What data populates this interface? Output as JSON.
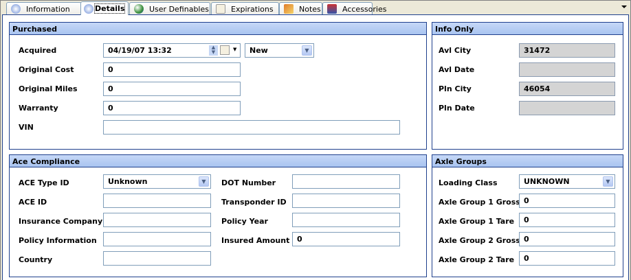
{
  "tabs": [
    {
      "label": "Information",
      "icon": "info-icon"
    },
    {
      "label": "Details",
      "icon": "info-icon"
    },
    {
      "label": "User Definables",
      "icon": "globe-icon"
    },
    {
      "label": "Expirations",
      "icon": "calendar-icon"
    },
    {
      "label": "Notes",
      "icon": "pencil-icon"
    },
    {
      "label": "Accessories",
      "icon": "accessories-icon"
    }
  ],
  "active_tab": "Details",
  "purchased": {
    "title": "Purchased",
    "acquired_label": "Acquired",
    "acquired_value": "04/19/07 13:32",
    "condition_value": "New",
    "original_cost_label": "Original Cost",
    "original_cost": "0",
    "original_miles_label": "Original Miles",
    "original_miles": "0",
    "warranty_label": "Warranty",
    "warranty": "0",
    "vin_label": "VIN",
    "vin": ""
  },
  "info_only": {
    "title": "Info Only",
    "avl_city_label": "Avl City",
    "avl_city": "31472",
    "avl_date_label": "Avl Date",
    "avl_date": "",
    "pln_city_label": "Pln City",
    "pln_city": "46054",
    "pln_date_label": "Pln Date",
    "pln_date": ""
  },
  "ace": {
    "title": "Ace Compliance",
    "type_id_label": "ACE Type ID",
    "type_id": "Unknown",
    "ace_id_label": "ACE ID",
    "ace_id": "",
    "insurance_company_label": "Insurance Company",
    "insurance_company": "",
    "policy_information_label": "Policy Information",
    "policy_information": "",
    "country_label": "Country",
    "country": "",
    "dot_number_label": "DOT Number",
    "dot_number": "",
    "transponder_id_label": "Transponder ID",
    "transponder_id": "",
    "policy_year_label": "Policy Year",
    "policy_year": "",
    "insured_amount_label": "Insured Amount",
    "insured_amount": "0"
  },
  "axle": {
    "title": "Axle Groups",
    "loading_class_label": "Loading Class",
    "loading_class": "UNKNOWN",
    "g1_gross_label": "Axle Group 1 Gross",
    "g1_gross": "0",
    "g1_tare_label": "Axle Group 1 Tare",
    "g1_tare": "0",
    "g2_gross_label": "Axle Group 2 Gross",
    "g2_gross": "0",
    "g2_tare_label": "Axle Group 2 Tare",
    "g2_tare": "0"
  }
}
